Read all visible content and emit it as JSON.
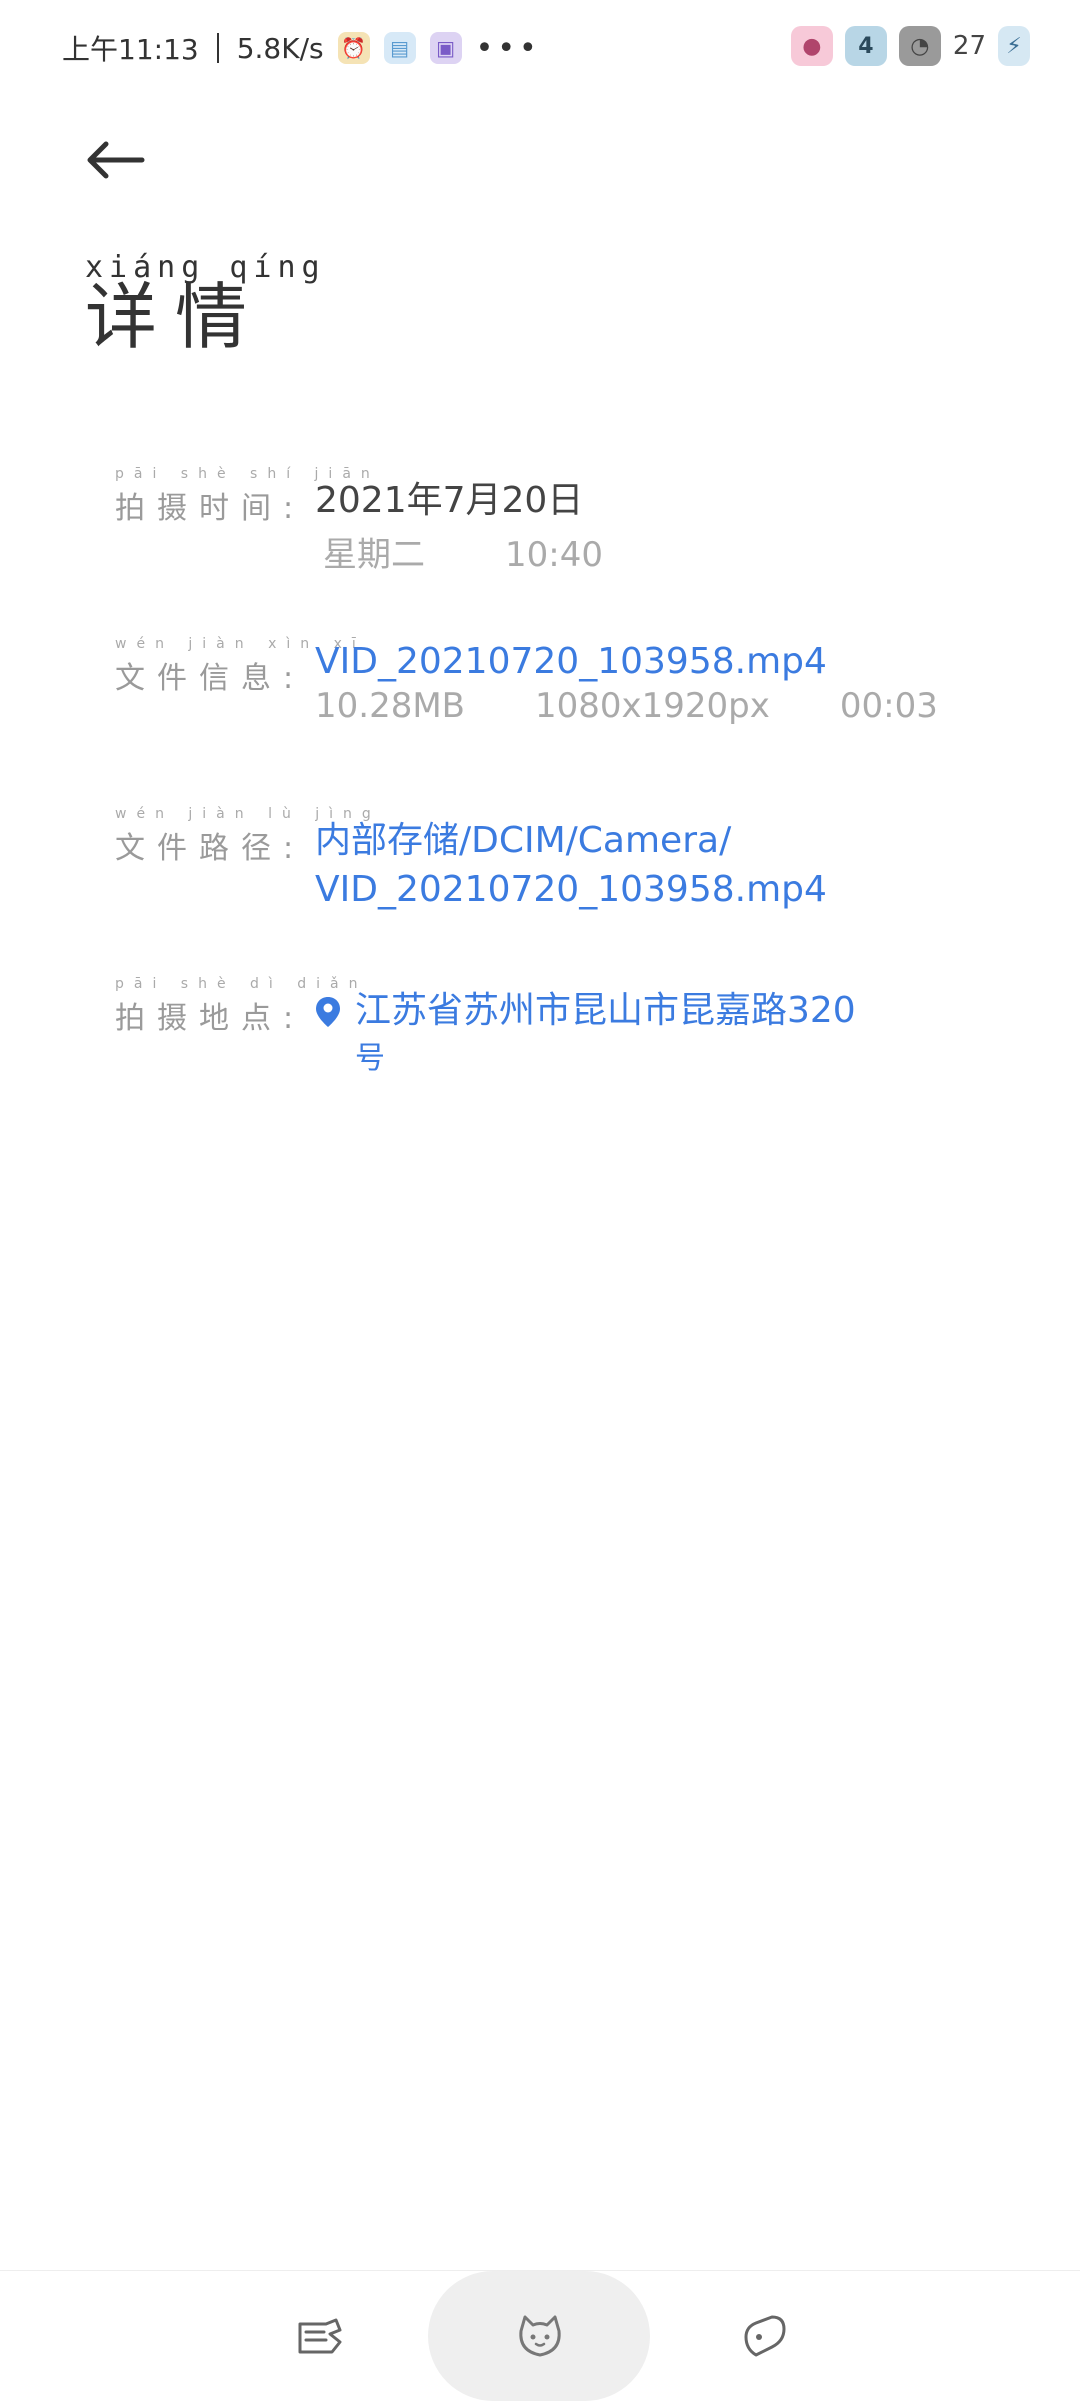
{
  "status_bar": {
    "time": "上午11:13",
    "speed": "5.8K/s",
    "battery": "27"
  },
  "header": {
    "title_pinyin": "xiáng qíng",
    "title": "详情"
  },
  "rows": {
    "time": {
      "label_pinyin": "pāi shè shí jiān",
      "label": "拍摄时间:",
      "date": "2021年7月20日",
      "weekday": "星期二",
      "clock": "10:40"
    },
    "file_info": {
      "label_pinyin": "wén jiàn xìn xī",
      "label": "文件信息:",
      "filename": "VID_20210720_103958.mp4",
      "size": "10.28MB",
      "resolution": "1080x1920px",
      "duration": "00:03"
    },
    "file_path": {
      "label_pinyin": "wén jiàn lù jìng",
      "label": "文件路径:",
      "line1": "内部存储/DCIM/Camera/",
      "line2": "VID_20210720_103958.mp4"
    },
    "location": {
      "label_pinyin": "pāi shè dì diǎn",
      "label": "拍摄地点:",
      "line1": "江苏省苏州市昆山市昆嘉路320",
      "line2": "号"
    }
  },
  "colors": {
    "accent": "#3b7be0",
    "label": "#9a9a9a",
    "text": "#444444"
  },
  "icons": {
    "back": "back-arrow-icon",
    "location": "location-pin-icon",
    "nav_left": "edit-icon",
    "nav_center": "cat-face-icon",
    "nav_right": "share-icon"
  }
}
